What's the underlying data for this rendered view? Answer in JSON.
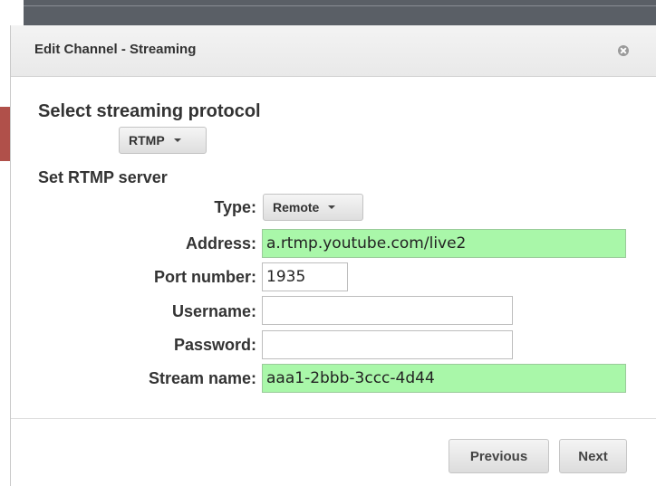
{
  "dialog": {
    "title": "Edit Channel - Streaming",
    "close_icon": "close-icon"
  },
  "protocol": {
    "heading": "Select streaming protocol",
    "selected": "RTMP"
  },
  "server": {
    "heading": "Set RTMP server",
    "type_label": "Type:",
    "type_selected": "Remote",
    "address_label": "Address:",
    "address_value": "a.rtmp.youtube.com/live2",
    "port_label": "Port number:",
    "port_value": "1935",
    "username_label": "Username:",
    "username_value": "",
    "password_label": "Password:",
    "password_value": "",
    "stream_label": "Stream name:",
    "stream_value": "aaa1-2bbb-3ccc-4d44"
  },
  "footer": {
    "previous_label": "Previous",
    "next_label": "Next"
  },
  "colors": {
    "valid_field": "#a9f7a9",
    "title_bar": "#efefef",
    "text": "#333333"
  }
}
